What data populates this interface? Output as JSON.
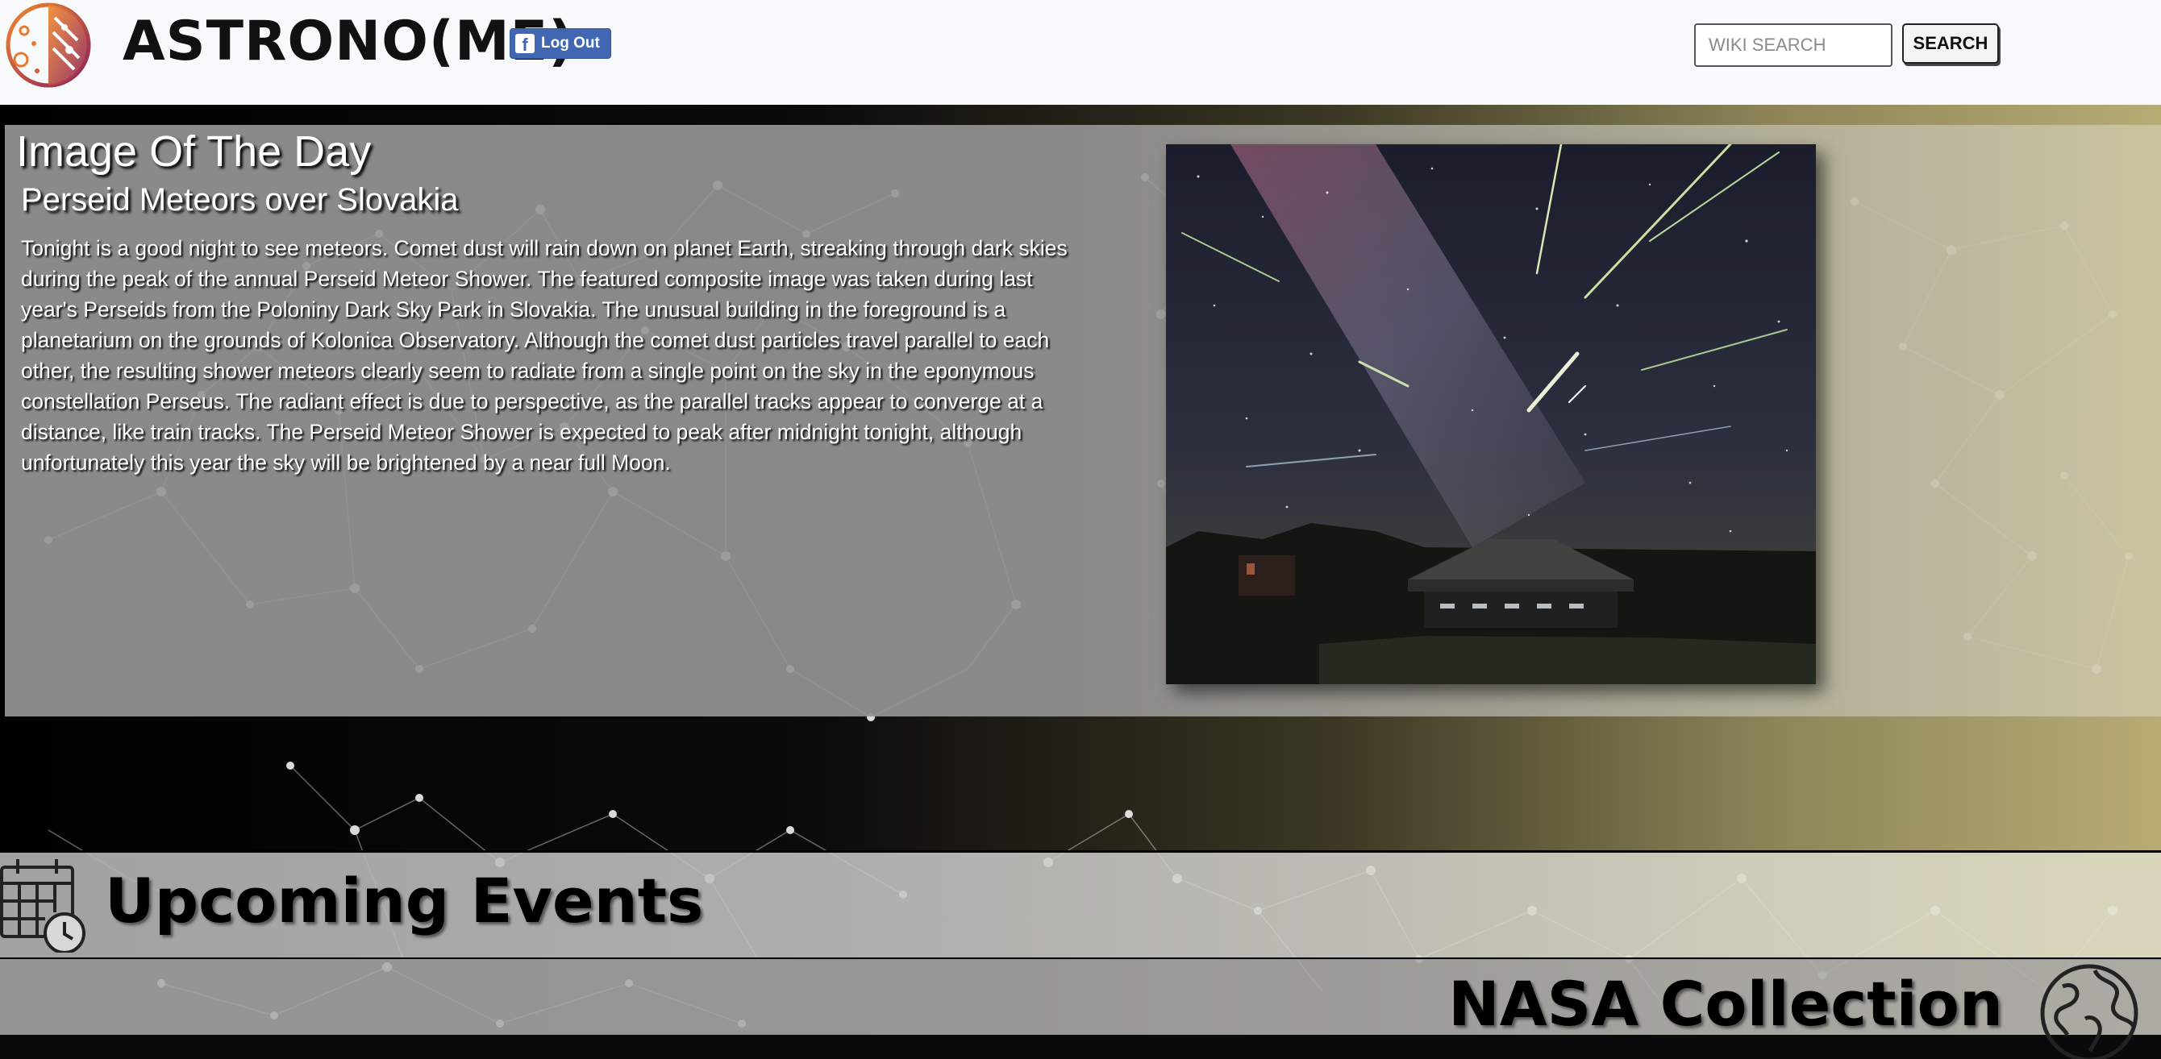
{
  "header": {
    "brand": "ASTRONO(ME)",
    "logout_label": "Log Out",
    "search_placeholder": "WIKI SEARCH",
    "search_button": "SEARCH"
  },
  "image_of_the_day": {
    "heading": "Image Of The Day",
    "title": "Perseid Meteors over Slovakia",
    "explanation": "Tonight is a good night to see meteors. Comet dust will rain down on planet Earth, streaking through dark skies during the peak of the annual Perseid Meteor Shower. The featured composite image was taken during last year's Perseids from the Poloniny Dark Sky Park in Slovakia. The unusual building in the foreground is a planetarium on the grounds of Kolonica Observatory. Although the comet dust particles travel parallel to each other, the resulting shower meteors clearly seem to radiate from a single point on the sky in the eponymous constellation Perseus. The radiant effect is due to perspective, as the parallel tracks appear to converge at a distance, like train tracks. The Perseid Meteor Shower is expected to peak after midnight tonight, although unfortunately this year the sky will be brightened by a near full Moon."
  },
  "sections": {
    "events_title": "Upcoming Events",
    "nasa_title": "NASA Collection"
  },
  "colors": {
    "facebook_blue": "#4267b2",
    "logo_gradient_start": "#e8792e",
    "logo_gradient_end": "#8b1e5a"
  },
  "icons": [
    "logo-icon",
    "facebook-icon",
    "calendar-clock-icon",
    "globe-icon"
  ]
}
